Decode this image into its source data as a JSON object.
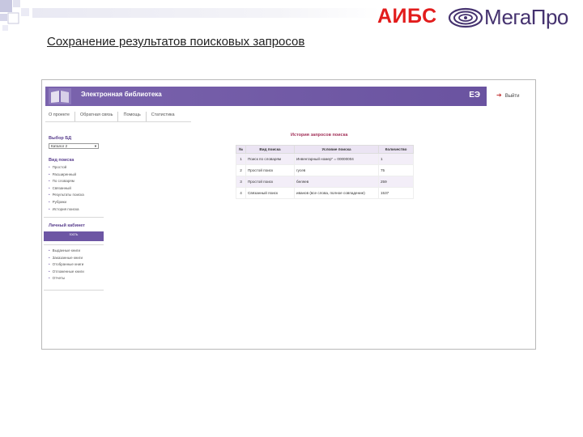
{
  "branding": {
    "aibs": "АИБС",
    "megapro": "МегаПро",
    "accent_red": "#e21c1c",
    "accent_purple": "#45326f"
  },
  "slide_title": "Сохранение результатов поисковых запросов",
  "app": {
    "header_title": "Электронная библиотека",
    "header_mark": "ЕЭ",
    "exit_label": "Выйти",
    "header_color": "#7a63ad",
    "nav": [
      "О проекте",
      "Обратная связь",
      "Помощь",
      "Статистика"
    ],
    "sidebar": {
      "db_heading": "Выбор БД",
      "db_selected": "Каталог 2",
      "search_heading": "Вид поиска",
      "search_items": [
        "Простой",
        "Расширенный",
        "По словарям",
        "Связанный",
        "Результаты поиска",
        "Рубрики",
        "История поиска"
      ],
      "cabinet_heading": "Личный кабинет",
      "guest_label": "гость",
      "cabinet_items": [
        "Выданные книги",
        "Заказанные книги",
        "Отобранные книги",
        "Отложенные книги",
        "Отчеты"
      ]
    },
    "history": {
      "title": "История запросов поиска",
      "columns": [
        "№",
        "Вид поиска",
        "Условие поиска",
        "Количество"
      ],
      "rows": [
        {
          "num": "1",
          "type": "Поиск по словарям",
          "condition": "Инвентарный номер\" = 00000004",
          "count": "1"
        },
        {
          "num": "2",
          "type": "Простой поиск",
          "condition": "гусев",
          "count": "75"
        },
        {
          "num": "3",
          "type": "Простой поиск",
          "condition": "беляев",
          "count": "259"
        },
        {
          "num": "4",
          "type": "Связанный поиск",
          "condition": "иванов (все слова, полное совпадение)",
          "count": "1537"
        }
      ]
    }
  }
}
